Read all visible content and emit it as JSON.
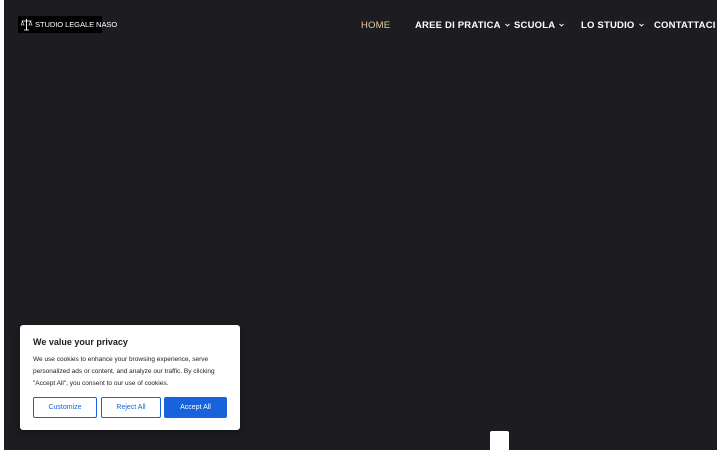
{
  "brand": {
    "logo_text": "STUDIO LEGALE NASO",
    "logo_icon": "scales-of-justice-icon"
  },
  "nav": {
    "items": [
      {
        "label": "HOME",
        "active": true,
        "has_dropdown": false
      },
      {
        "label": "AREE DI PRATICA",
        "active": false,
        "has_dropdown": true
      },
      {
        "label": "SCUOLA",
        "active": false,
        "has_dropdown": true
      },
      {
        "label": "LO STUDIO",
        "active": false,
        "has_dropdown": true
      },
      {
        "label": "CONTATTACI",
        "active": false,
        "has_dropdown": false
      }
    ]
  },
  "cookie_banner": {
    "title": "We value your privacy",
    "text": "We use cookies to enhance your browsing experience, serve personalized ads or content, and analyze our traffic. By clicking \"Accept All\", you consent to our use of cookies.",
    "customize_label": "Customize",
    "reject_label": "Reject All",
    "accept_label": "Accept All"
  },
  "colors": {
    "background": "#1c1c21",
    "nav_active": "#e7c9a5",
    "accent_blue": "#1863dc"
  }
}
